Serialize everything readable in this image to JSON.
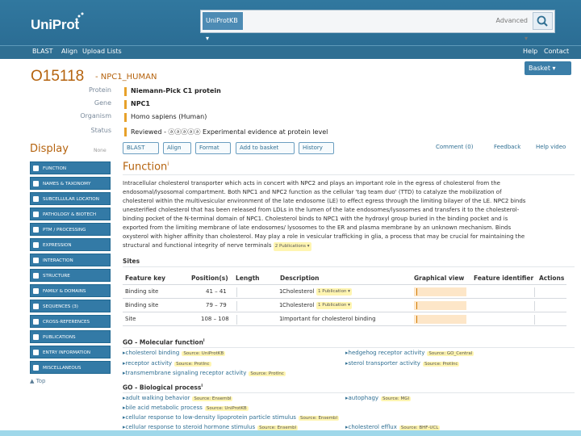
{
  "header": {
    "logo": "UniProt",
    "search_scope": "UniProtKB ▾",
    "search_placeholder": "",
    "advanced_label": "Advanced ▾"
  },
  "nav": {
    "blast": "BLAST",
    "align": "Align",
    "upload_lists": "Upload Lists",
    "help": "Help",
    "contact": "Contact"
  },
  "entry": {
    "accession": "O15118",
    "name": "- NPC1_HUMAN",
    "basket": "Basket ▾"
  },
  "props": [
    {
      "label": "Protein",
      "value": "Niemann-Pick C1 protein"
    },
    {
      "label": "Gene",
      "value": "NPC1"
    },
    {
      "label": "Organism",
      "value": "Homo sapiens (Human)"
    },
    {
      "label": "Status",
      "value": "Reviewed - ⓐⓐⓐⓐⓐ Experimental evidence at protein level"
    }
  ],
  "sidebar": {
    "title": "Display",
    "none_label": "None",
    "items": [
      "FUNCTION",
      "NAMES & TAXONOMY",
      "SUBCELLULAR LOCATION",
      "PATHOLOGY & BIOTECH",
      "PTM / PROCESSING",
      "EXPRESSION",
      "INTERACTION",
      "STRUCTURE",
      "FAMILY & DOMAINS",
      "SEQUENCES (3)",
      "CROSS-REFERENCES",
      "PUBLICATIONS",
      "ENTRY INFORMATION",
      "MISCELLANEOUS"
    ],
    "hide_all": "▲ Top"
  },
  "toolbar": {
    "blast": "BLAST",
    "align": "Align",
    "format": "Format",
    "add_to_basket": "Add to basket",
    "history": "History",
    "comment": "Comment (0)",
    "feedback": "Feedback",
    "help_video": "Help video"
  },
  "function": {
    "title": "Function",
    "title_sup": "i",
    "text": "Intracellular cholesterol transporter which acts in concert with NPC2 and plays an important role in the egress of cholesterol from the\nendosomal/lysosomal compartment. Both NPC1 and NPC2 function as the cellular 'tag team duo' (TTD) to catalyze the mobilization of\ncholesterol within the multivesicular environment of the late endosome (LE) to effect egress through the limiting bilayer of the LE. NPC2 binds\nunesterified cholesterol that has been released from LDLs in the lumen of the late endosomes/lysosomes and transfers it to the cholesterol-\nbinding pocket of the N-terminal domain of NPC1. Cholesterol binds to NPC1 with the hydroxyl group buried in the binding pocket and is\nexported from the limiting membrane of late endosomes/ lysosomes to the ER and plasma membrane by an unknown mechanism. Binds\noxysterol with higher affinity than cholesterol. May play a role in vesicular trafficking in glia, a process that may be crucial for maintaining the\nstructural and functional integrity of nerve terminals",
    "pub_badge": "2 Publications ▾"
  },
  "sites": {
    "title": "Sites",
    "headers": [
      "Feature key",
      "Position(s)",
      "Length",
      "Description",
      "Graphical view",
      "Feature identifier",
      "Actions"
    ],
    "rows": [
      {
        "key": "Binding site",
        "pos": "41 – 41",
        "len": "1",
        "desc": "Cholesterol",
        "badge": "1 Publication ▾"
      },
      {
        "key": "Binding site",
        "pos": "79 – 79",
        "len": "1",
        "desc": "Cholesterol",
        "badge": "1 Publication ▾"
      },
      {
        "key": "Site",
        "pos": "108 – 108",
        "len": "1",
        "desc": "Important for cholesterol binding",
        "badge": ""
      }
    ]
  },
  "go_mf": {
    "title": "GO - Molecular function",
    "sup": "i",
    "left": [
      {
        "term": "cholesterol binding",
        "src": "Source: UniProtKB"
      },
      {
        "term": "receptor activity",
        "src": "Source: ProtInc"
      },
      {
        "term": "transmembrane signaling receptor activity",
        "src": "Source: ProtInc"
      }
    ],
    "right": [
      {
        "term": "hedgehog receptor activity",
        "src": "Source: GO_Central"
      },
      {
        "term": "sterol transporter activity",
        "src": "Source: ProtInc"
      }
    ]
  },
  "go_bp": {
    "title": "GO - Biological process",
    "sup": "i",
    "left": [
      {
        "term": "adult walking behavior",
        "src": "Source: Ensembl"
      },
      {
        "term": "bile acid metabolic process",
        "src": "Source: UniProtKB"
      },
      {
        "term": "cellular response to low-density lipoprotein particle stimulus",
        "src": "Source: Ensembl"
      },
      {
        "term": "cellular response to steroid hormone stimulus",
        "src": "Source: Ensembl"
      }
    ],
    "right": [
      {
        "term": "autophagy",
        "src": "Source: MGI"
      },
      {
        "term": "cholesterol efflux",
        "src": "Source: BHF-UCL"
      }
    ]
  }
}
